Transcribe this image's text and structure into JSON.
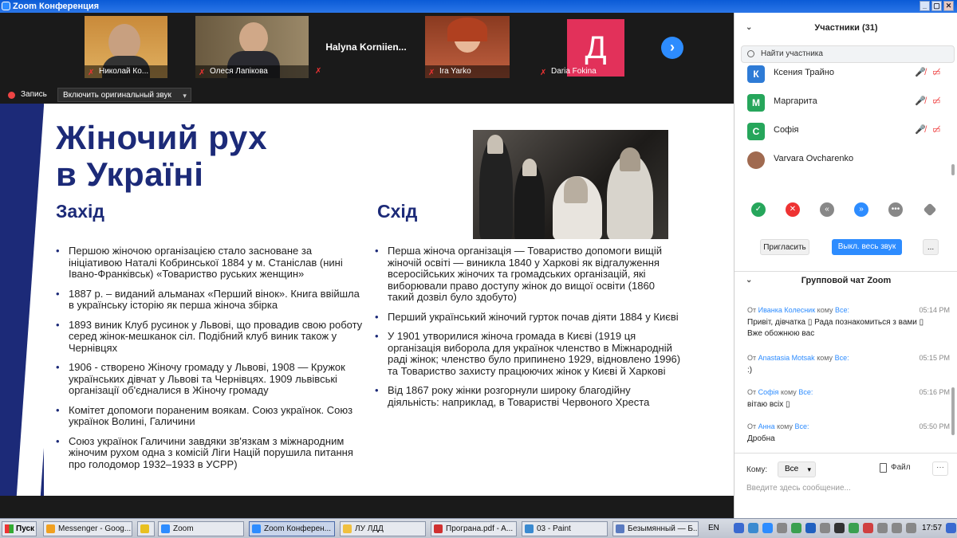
{
  "window": {
    "title": "Zoom Конференция"
  },
  "gallery": {
    "tiles": [
      {
        "name": "Николай Ко..."
      },
      {
        "name": "Олеся Лапікова"
      },
      {
        "name": "Halyna  Korniien..."
      },
      {
        "name": "Ira Yarko"
      },
      {
        "name": "Daria Fokina",
        "initial": "Д"
      }
    ]
  },
  "recording": {
    "label": "Запись",
    "original_sound": "Включить оригинальный звук"
  },
  "slide": {
    "title_line1": "Жіночий рух",
    "title_line2": "в Україні",
    "west_heading": "Захід",
    "east_heading": "Схід",
    "west_items": [
      "Першою жіночою організацією стало засноване за ініціативою Наталі Кобринської 1884 у м. Станіслав (нині Івано-Франківськ) «Товариство руських женщин»",
      "1887 р. – виданий альманах «Перший вінок». Книга ввійшла в українську історію як перша жіноча збірка",
      "1893 виник Клуб русинок у Львові, що провадив свою роботу серед жінок-мешканок сіл. Подібний клуб виник також у Чернівцях",
      "1906 - створено Жіночу громаду у Львові, 1908 — Кружок українських дівчат у Львові та Чернівцях. 1909 львівські організації об'єдналися в Жіночу громаду",
      "Комітет допомоги пораненим воякам. Союз українок. Союз українок Волині, Галичини",
      "Союз українок Галичини завдяки зв'язкам з міжнародним жіночим рухом одна з комісій Ліги Націй порушила питання про голодомор 1932–1933 в УСРР)"
    ],
    "east_items": [
      "Перша жіноча організація — Товариство допомоги вищій жіночій освіті — виникла 1840 у Харкові як відгалуження всеросійських жіночих та громадських організацій, які виборювали право доступу жінок до вищої освіти (1860 такий дозвіл було здобуто)",
      "Перший український жіночий гурток почав діяти 1884 у Києві",
      "У 1901 утворилися жіноча громада в Києві (1919 ця організація виборола для українок членство в Міжнародній раді жінок; членство було припинено 1929, відновлено 1996) та Товариство захисту працюючих жінок у Києві й Харкові",
      "Від 1867 року жінки розгорнули широку благодійну діяльність: наприклад, в Товаристві Червоного Хреста"
    ]
  },
  "participants": {
    "header": "Участники (31)",
    "search_placeholder": "Найти участника",
    "list": [
      {
        "initial": "К",
        "name": "Ксения Трайно",
        "color": "#2e7bd6"
      },
      {
        "initial": "М",
        "name": "Маргарита",
        "color": "#26a65b"
      },
      {
        "initial": "С",
        "name": "Софія",
        "color": "#26a65b"
      },
      {
        "initial": "",
        "name": "Varvara Ovcharenko",
        "color": "#a06a50"
      }
    ],
    "invite": "Пригласить",
    "mute_all": "Выкл. весь звук",
    "more": "..."
  },
  "chat": {
    "header": "Групповой чат Zoom",
    "messages": [
      {
        "from_prefix": "От",
        "from": "Иванка Колесник",
        "to_prefix": "кому",
        "to": "Все:",
        "time": "05:14 PM",
        "text": "Привіт, дівчатка ▯ Рада познакомиться з вами ▯ Вже обожнюю вас"
      },
      {
        "from_prefix": "От",
        "from": "Anastasia Motsak",
        "to_prefix": "кому",
        "to": "Все:",
        "time": "05:15 PM",
        "text": ":)"
      },
      {
        "from_prefix": "От",
        "from": "Софія",
        "to_prefix": "кому",
        "to": "Все:",
        "time": "05:16 PM",
        "text": "вітаю всіх ▯"
      },
      {
        "from_prefix": "От",
        "from": "Анна",
        "to_prefix": "кому",
        "to": "Все:",
        "time": "05:50 PM",
        "text": "Дробна"
      }
    ],
    "to_label": "Кому:",
    "to_value": "Все",
    "file_label": "Файл",
    "input_placeholder": "Введите здесь сообщение..."
  },
  "taskbar": {
    "start": "Пуск",
    "items": [
      {
        "label": "Messenger - Goog...",
        "color": "#f0a020"
      },
      {
        "label": "",
        "color": "#e8c020"
      },
      {
        "label": "Zoom",
        "color": "#2d8cff"
      },
      {
        "label": "Zoom Конферен...",
        "color": "#2d8cff"
      },
      {
        "label": "ЛУ ЛДД",
        "color": "#f0c040"
      },
      {
        "label": "Програна.pdf - A...",
        "color": "#d03030"
      },
      {
        "label": "03 - Paint",
        "color": "#3a8ad0"
      },
      {
        "label": "Безымянный — Б...",
        "color": "#5a7ac0"
      }
    ],
    "lang": "EN",
    "clock": "17:57"
  }
}
